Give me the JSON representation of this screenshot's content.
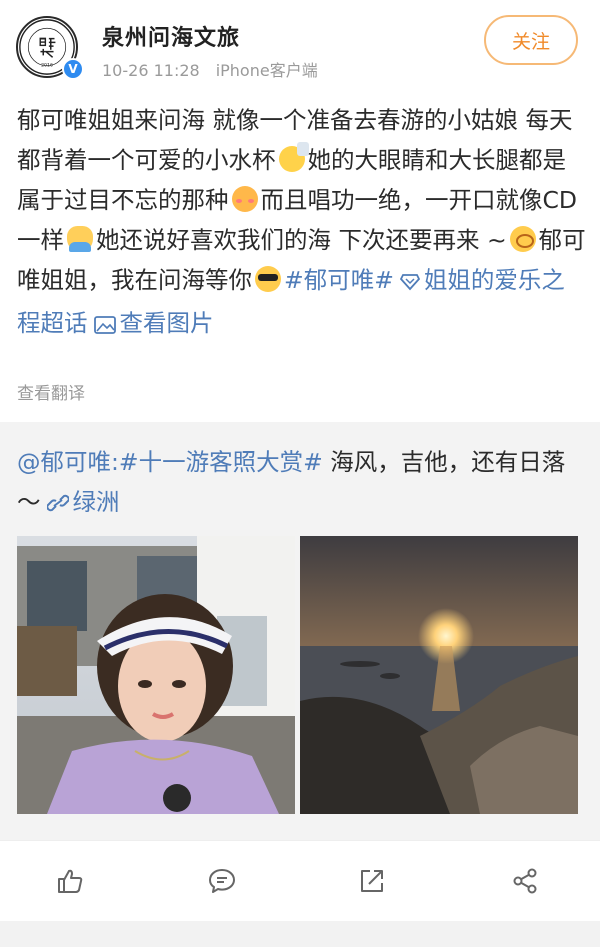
{
  "header": {
    "username": "泉州问海文旅",
    "time": "10-26 11:28",
    "source": "iPhone客户端",
    "follow_label": "关注",
    "avatar_icon": "wenhai-coffee-logo",
    "verified_icon": "verified-badge-icon",
    "avatar_logo_text": "Wen Hai Coffee Casual Restaurant 2016",
    "verified_mark": "V"
  },
  "post": {
    "seg1": "郁可唯姐姐来问海 就像一个准备去春游的小姑娘 每天都背着一个可爱的小水杯",
    "seg2": "她的大眼睛和大长腿都是属于过目不忘的那种",
    "seg3": "而且唱功一绝，一开口就像CD一样",
    "seg4": "她还说好喜欢我们的海 下次还要再来 ~",
    "seg5": "郁可唯姐姐，我在问海等你",
    "tag1": "#郁可唯#",
    "supertopic": "姐姐的爱乐之程超话",
    "view_image": "查看图片",
    "translate": "查看翻译"
  },
  "repost": {
    "mention": "@郁可唯:",
    "topic": "#十一游客照大赏#",
    "text": " 海风，吉他，还有日落～",
    "location": "绿洲",
    "photos": [
      "selfie-photo",
      "sunset-sea-photo"
    ]
  },
  "actions": {
    "icons": [
      "like-icon",
      "comment-icon",
      "repost-icon",
      "share-icon"
    ]
  },
  "colors": {
    "link": "#4f7cb8",
    "follow": "#f08a2a",
    "follow_border": "#f6b976",
    "meta": "#9a9a9a",
    "repost_bg": "#f3f3f3"
  }
}
